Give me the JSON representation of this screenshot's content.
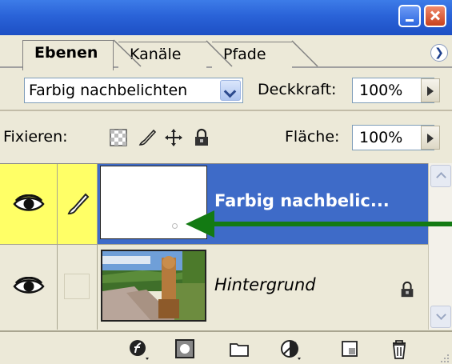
{
  "window": {
    "minimize_icon": "minimize-icon",
    "close_icon": "close-icon",
    "title_color": "#2a63d8"
  },
  "tabs": [
    {
      "label": "Ebenen",
      "active": true
    },
    {
      "label": "Kanäle",
      "active": false
    },
    {
      "label": "Pfade",
      "active": false
    }
  ],
  "panel_menu_icon": "panel-menu-icon",
  "blend": {
    "mode": "Farbig nachbelichten",
    "opacity_label": "Deckkraft:",
    "opacity_value": "100%"
  },
  "lock": {
    "label": "Fixieren:",
    "icons": [
      "lock-transparency-icon",
      "lock-image-icon",
      "lock-position-icon",
      "lock-all-icon"
    ],
    "fill_label": "Fläche:",
    "fill_value": "100%"
  },
  "layers": [
    {
      "name": "Farbig nachbelic...",
      "selected": true,
      "visible": true,
      "has_brush": true,
      "locked": false
    },
    {
      "name": "Hintergrund",
      "selected": false,
      "visible": true,
      "has_brush": false,
      "locked": true
    }
  ],
  "bottom_toolbar_icons": [
    "layer-style-icon",
    "layer-mask-icon",
    "new-group-icon",
    "adjustment-layer-icon",
    "new-layer-icon",
    "delete-layer-icon"
  ],
  "colors": {
    "selected_layer": "#3e6bc8",
    "visibility_cell": "#ffff66",
    "annotation_arrow": "#137a13",
    "panel_background": "#ece9d8"
  }
}
